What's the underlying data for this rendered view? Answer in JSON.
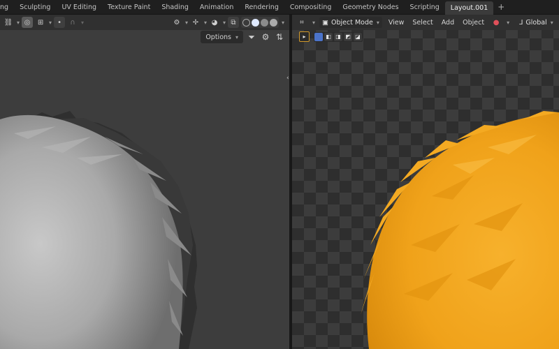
{
  "workspace_tabs": [
    {
      "label": "ng",
      "active": false
    },
    {
      "label": "Sculpting",
      "active": false
    },
    {
      "label": "UV Editing",
      "active": false
    },
    {
      "label": "Texture Paint",
      "active": false
    },
    {
      "label": "Shading",
      "active": false
    },
    {
      "label": "Animation",
      "active": false
    },
    {
      "label": "Rendering",
      "active": false
    },
    {
      "label": "Compositing",
      "active": false
    },
    {
      "label": "Geometry Nodes",
      "active": false
    },
    {
      "label": "Scripting",
      "active": false
    },
    {
      "label": "Layout.001",
      "active": true
    }
  ],
  "add_workspace": "+",
  "left_view": {
    "options_label": "Options",
    "shading_colors": [
      "#9a9a9a",
      "#dfe9ff",
      "#8b8b8b",
      "#aaaaaa"
    ]
  },
  "right_view": {
    "mode_label": "Object Mode",
    "menus": [
      "View",
      "Select",
      "Add",
      "Object"
    ],
    "orientation_label": "Global"
  },
  "colors": {
    "accent_active": "#d39a2a",
    "fur_orange": "#f0a21a",
    "fur_gray": "#a9a9a9",
    "selection_blue": "#4b73c9"
  }
}
